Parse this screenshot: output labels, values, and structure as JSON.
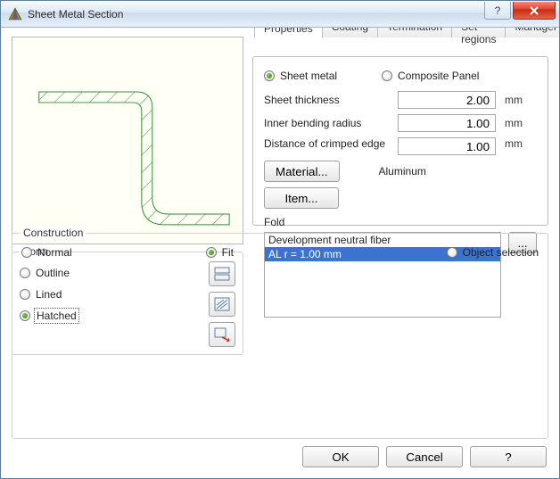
{
  "window": {
    "title": "Sheet Metal Section"
  },
  "tabs": {
    "properties": "Properties",
    "coating": "Coating",
    "termination": "Termination",
    "set_regions": "Set regions",
    "manager": "Manager"
  },
  "properties": {
    "type": {
      "sheet_metal": "Sheet metal",
      "composite_panel": "Composite Panel",
      "selected": "sheet_metal"
    },
    "thickness_label": "Sheet thickness",
    "thickness_value": "2.00",
    "thickness_unit": "mm",
    "radius_label": "Inner bending radius",
    "radius_value": "1.00",
    "radius_unit": "mm",
    "crimp_label": "Distance of crimped edge",
    "crimp_value": "1.00",
    "crimp_unit": "mm",
    "material_btn": "Material...",
    "material_value": "Aluminum",
    "item_btn": "Item...",
    "fold_label": "Fold",
    "fold_items": {
      "0": "Development neutral fiber",
      "1": "AL r = 1.00 mm"
    },
    "fold_selected_index": 1,
    "ellipsis": "..."
  },
  "form": {
    "legend": "Form",
    "outline": "Outline",
    "lined": "Lined",
    "hatched": "Hatched",
    "selected": "hatched"
  },
  "construction": {
    "legend": "Construction",
    "normal": "Normal",
    "fit": "Fit",
    "object_selection": "Object selection",
    "selected": "fit"
  },
  "buttons": {
    "ok": "OK",
    "cancel": "Cancel",
    "help": "?"
  }
}
